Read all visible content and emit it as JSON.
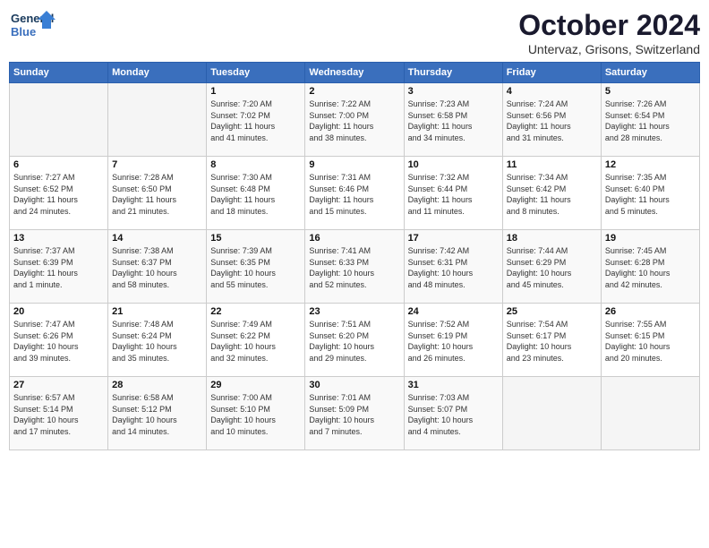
{
  "logo": {
    "line1": "General",
    "line2": "Blue"
  },
  "title": "October 2024",
  "subtitle": "Untervaz, Grisons, Switzerland",
  "days_of_week": [
    "Sunday",
    "Monday",
    "Tuesday",
    "Wednesday",
    "Thursday",
    "Friday",
    "Saturday"
  ],
  "weeks": [
    [
      {
        "day": "",
        "info": ""
      },
      {
        "day": "",
        "info": ""
      },
      {
        "day": "1",
        "info": "Sunrise: 7:20 AM\nSunset: 7:02 PM\nDaylight: 11 hours\nand 41 minutes."
      },
      {
        "day": "2",
        "info": "Sunrise: 7:22 AM\nSunset: 7:00 PM\nDaylight: 11 hours\nand 38 minutes."
      },
      {
        "day": "3",
        "info": "Sunrise: 7:23 AM\nSunset: 6:58 PM\nDaylight: 11 hours\nand 34 minutes."
      },
      {
        "day": "4",
        "info": "Sunrise: 7:24 AM\nSunset: 6:56 PM\nDaylight: 11 hours\nand 31 minutes."
      },
      {
        "day": "5",
        "info": "Sunrise: 7:26 AM\nSunset: 6:54 PM\nDaylight: 11 hours\nand 28 minutes."
      }
    ],
    [
      {
        "day": "6",
        "info": "Sunrise: 7:27 AM\nSunset: 6:52 PM\nDaylight: 11 hours\nand 24 minutes."
      },
      {
        "day": "7",
        "info": "Sunrise: 7:28 AM\nSunset: 6:50 PM\nDaylight: 11 hours\nand 21 minutes."
      },
      {
        "day": "8",
        "info": "Sunrise: 7:30 AM\nSunset: 6:48 PM\nDaylight: 11 hours\nand 18 minutes."
      },
      {
        "day": "9",
        "info": "Sunrise: 7:31 AM\nSunset: 6:46 PM\nDaylight: 11 hours\nand 15 minutes."
      },
      {
        "day": "10",
        "info": "Sunrise: 7:32 AM\nSunset: 6:44 PM\nDaylight: 11 hours\nand 11 minutes."
      },
      {
        "day": "11",
        "info": "Sunrise: 7:34 AM\nSunset: 6:42 PM\nDaylight: 11 hours\nand 8 minutes."
      },
      {
        "day": "12",
        "info": "Sunrise: 7:35 AM\nSunset: 6:40 PM\nDaylight: 11 hours\nand 5 minutes."
      }
    ],
    [
      {
        "day": "13",
        "info": "Sunrise: 7:37 AM\nSunset: 6:39 PM\nDaylight: 11 hours\nand 1 minute."
      },
      {
        "day": "14",
        "info": "Sunrise: 7:38 AM\nSunset: 6:37 PM\nDaylight: 10 hours\nand 58 minutes."
      },
      {
        "day": "15",
        "info": "Sunrise: 7:39 AM\nSunset: 6:35 PM\nDaylight: 10 hours\nand 55 minutes."
      },
      {
        "day": "16",
        "info": "Sunrise: 7:41 AM\nSunset: 6:33 PM\nDaylight: 10 hours\nand 52 minutes."
      },
      {
        "day": "17",
        "info": "Sunrise: 7:42 AM\nSunset: 6:31 PM\nDaylight: 10 hours\nand 48 minutes."
      },
      {
        "day": "18",
        "info": "Sunrise: 7:44 AM\nSunset: 6:29 PM\nDaylight: 10 hours\nand 45 minutes."
      },
      {
        "day": "19",
        "info": "Sunrise: 7:45 AM\nSunset: 6:28 PM\nDaylight: 10 hours\nand 42 minutes."
      }
    ],
    [
      {
        "day": "20",
        "info": "Sunrise: 7:47 AM\nSunset: 6:26 PM\nDaylight: 10 hours\nand 39 minutes."
      },
      {
        "day": "21",
        "info": "Sunrise: 7:48 AM\nSunset: 6:24 PM\nDaylight: 10 hours\nand 35 minutes."
      },
      {
        "day": "22",
        "info": "Sunrise: 7:49 AM\nSunset: 6:22 PM\nDaylight: 10 hours\nand 32 minutes."
      },
      {
        "day": "23",
        "info": "Sunrise: 7:51 AM\nSunset: 6:20 PM\nDaylight: 10 hours\nand 29 minutes."
      },
      {
        "day": "24",
        "info": "Sunrise: 7:52 AM\nSunset: 6:19 PM\nDaylight: 10 hours\nand 26 minutes."
      },
      {
        "day": "25",
        "info": "Sunrise: 7:54 AM\nSunset: 6:17 PM\nDaylight: 10 hours\nand 23 minutes."
      },
      {
        "day": "26",
        "info": "Sunrise: 7:55 AM\nSunset: 6:15 PM\nDaylight: 10 hours\nand 20 minutes."
      }
    ],
    [
      {
        "day": "27",
        "info": "Sunrise: 6:57 AM\nSunset: 5:14 PM\nDaylight: 10 hours\nand 17 minutes."
      },
      {
        "day": "28",
        "info": "Sunrise: 6:58 AM\nSunset: 5:12 PM\nDaylight: 10 hours\nand 14 minutes."
      },
      {
        "day": "29",
        "info": "Sunrise: 7:00 AM\nSunset: 5:10 PM\nDaylight: 10 hours\nand 10 minutes."
      },
      {
        "day": "30",
        "info": "Sunrise: 7:01 AM\nSunset: 5:09 PM\nDaylight: 10 hours\nand 7 minutes."
      },
      {
        "day": "31",
        "info": "Sunrise: 7:03 AM\nSunset: 5:07 PM\nDaylight: 10 hours\nand 4 minutes."
      },
      {
        "day": "",
        "info": ""
      },
      {
        "day": "",
        "info": ""
      }
    ]
  ]
}
